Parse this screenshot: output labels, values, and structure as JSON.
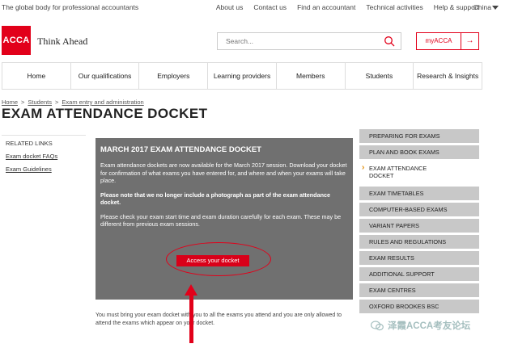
{
  "utility": {
    "tagline": "The global body for professional accountants",
    "links": [
      "About us",
      "Contact us",
      "Find an accountant",
      "Technical activities",
      "Help & support"
    ],
    "country": "China"
  },
  "header": {
    "logo": "ACCA",
    "tagline": "Think Ahead",
    "search_placeholder": "Search...",
    "myacca": "myACCA",
    "myacca_arrow": "→"
  },
  "nav": [
    "Home",
    "Our qualifications",
    "Employers",
    "Learning providers",
    "Members",
    "Students",
    "Research & Insights"
  ],
  "breadcrumb": {
    "items": [
      "Home",
      "Students",
      "Exam entry and administration"
    ],
    "sep": ">"
  },
  "page_title": "EXAM ATTENDANCE DOCKET",
  "related": {
    "heading": "RELATED LINKS",
    "links": [
      "Exam docket FAQs",
      "Exam Guidelines"
    ]
  },
  "panel": {
    "heading": "MARCH 2017 EXAM ATTENDANCE DOCKET",
    "p1": "Exam attendance dockets are now available for the March 2017 session. Download your docket for confirmation of what exams you have entered for, and where and when your exams will take place.",
    "p2": "Please note that we no longer include a photograph as part of the exam attendance docket.",
    "p3": "Please check your exam start time and exam duration carefully for each exam. These may be different from previous exam sessions.",
    "button": "Access your docket"
  },
  "bottom_text": "You must bring your exam docket with you to all the exams you attend and you are only allowed to attend the exams which appear on your docket.",
  "side_nav": [
    {
      "label": "PREPARING FOR EXAMS",
      "active": false
    },
    {
      "label": "PLAN AND BOOK EXAMS",
      "active": false
    },
    {
      "label": "EXAM ATTENDANCE DOCKET",
      "active": true
    },
    {
      "label": "EXAM TIMETABLES",
      "active": false
    },
    {
      "label": "COMPUTER-BASED EXAMS",
      "active": false
    },
    {
      "label": "VARIANT PAPERS",
      "active": false
    },
    {
      "label": "RULES AND REGULATIONS",
      "active": false
    },
    {
      "label": "EXAM RESULTS",
      "active": false
    },
    {
      "label": "ADDITIONAL SUPPORT",
      "active": false
    },
    {
      "label": "EXAM CENTRES",
      "active": false
    },
    {
      "label": "OXFORD BROOKES BSC",
      "active": false
    }
  ],
  "watermark": "泽霞ACCA考友论坛",
  "colors": {
    "brand": "#e2001a",
    "panel": "#707070",
    "side_item": "#c8c8c8"
  }
}
